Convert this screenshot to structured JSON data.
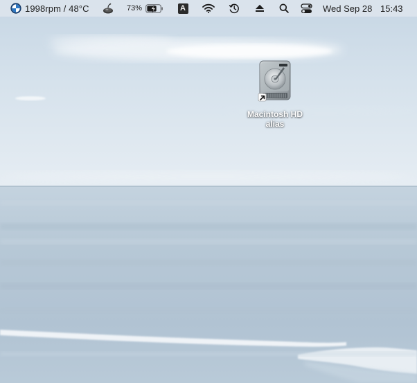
{
  "menubar": {
    "fan_status": "1998rpm / 48°C",
    "battery": {
      "percent_text": "73%",
      "level": 0.73,
      "charging": true
    },
    "input_source_letter": "A",
    "date": "Wed Sep 28",
    "time": "15:43",
    "icons": [
      "fan-control-icon",
      "bomb-icon",
      "battery-icon",
      "input-source-icon",
      "wifi-icon",
      "time-machine-icon",
      "eject-icon",
      "spotlight-search-icon",
      "control-center-icon"
    ]
  },
  "desktop": {
    "wallpaper": "coastal-sea-and-sky",
    "items": [
      {
        "name_line1": "Macintosh HD",
        "name_line2": "alias",
        "icon": "hard-drive-alias-icon"
      }
    ]
  },
  "colors": {
    "menubar_bg": "#E2E8EE",
    "sky_top": "#C9D8E5",
    "sky_horizon": "#E4ECF3",
    "sea": "#B9CBD9"
  }
}
